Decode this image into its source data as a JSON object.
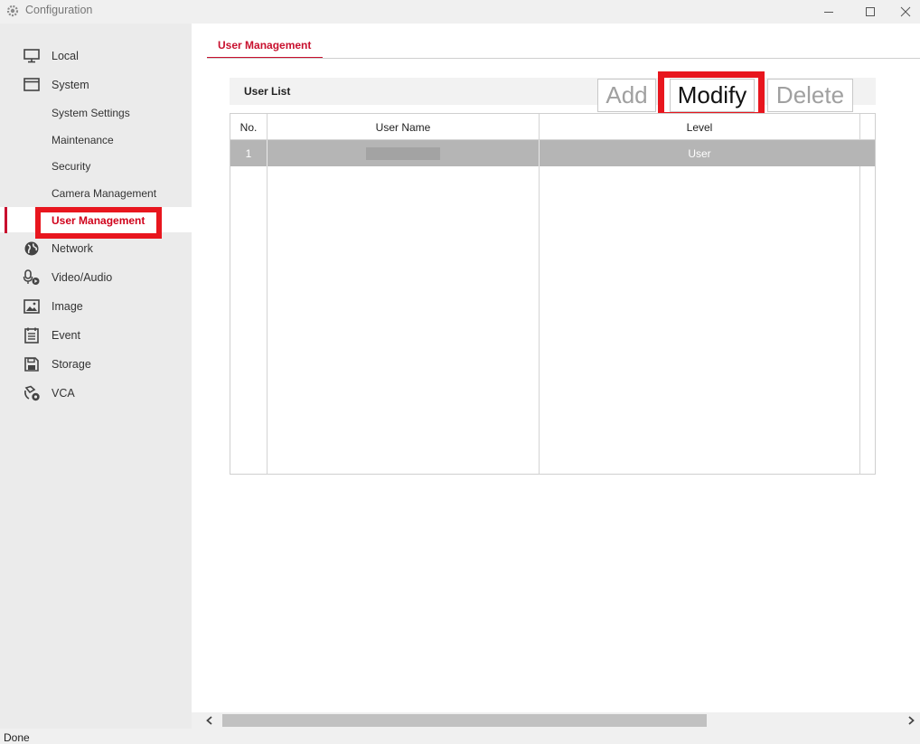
{
  "window": {
    "title": "Configuration"
  },
  "sidebar": {
    "items": [
      {
        "label": "Local",
        "icon": "monitor-icon"
      },
      {
        "label": "System",
        "icon": "window-icon"
      },
      {
        "label": "Network",
        "icon": "globe-icon"
      },
      {
        "label": "Video/Audio",
        "icon": "microphone-icon"
      },
      {
        "label": "Image",
        "icon": "image-icon"
      },
      {
        "label": "Event",
        "icon": "calendar-icon"
      },
      {
        "label": "Storage",
        "icon": "floppy-disk-icon"
      },
      {
        "label": "VCA",
        "icon": "vca-icon"
      }
    ],
    "system_sub": [
      {
        "label": "System Settings"
      },
      {
        "label": "Maintenance"
      },
      {
        "label": "Security"
      },
      {
        "label": "Camera Management"
      },
      {
        "label": "User Management"
      }
    ]
  },
  "main": {
    "tab_label": "User Management",
    "list_title": "User List",
    "buttons": {
      "add": "Add",
      "modify": "Modify",
      "delete": "Delete"
    },
    "table": {
      "headers": [
        "No.",
        "User Name",
        "Level"
      ],
      "rows": [
        {
          "no": "1",
          "user_name": "",
          "level": "User"
        }
      ]
    }
  },
  "status": {
    "text": "Done"
  },
  "colors": {
    "accent": "#c8102e",
    "highlight": "#e8161e",
    "selected_row": "#b5b5b5"
  }
}
